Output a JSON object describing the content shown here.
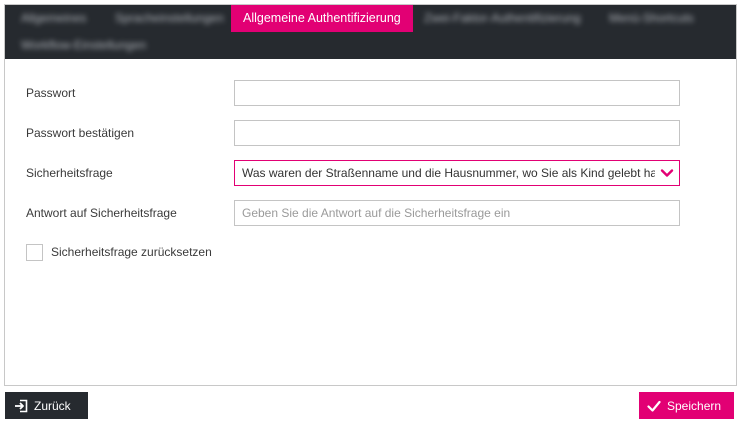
{
  "tabs": [
    {
      "label": "Allgemeines",
      "blurred": true
    },
    {
      "label": "Spracheinstellungen",
      "blurred": true
    },
    {
      "label": "Allgemeine Authentifizierung",
      "blurred": false,
      "active": true
    },
    {
      "label": "Zwei-Faktor-Authentifizierung",
      "blurred": true
    },
    {
      "label": "Menü-Shortcuts",
      "blurred": true
    },
    {
      "label": "Workflow-Einstellungen",
      "blurred": true
    }
  ],
  "form": {
    "password_label": "Passwort",
    "password_value": "",
    "confirm_label": "Passwort bestätigen",
    "confirm_value": "",
    "question_label": "Sicherheitsfrage",
    "question_selected": "Was waren der Straßenname und die Hausnummer, wo Sie als Kind gelebt haben?",
    "answer_label": "Antwort auf Sicherheitsfrage",
    "answer_placeholder": "Geben Sie die Antwort auf die Sicherheitsfrage ein",
    "reset_label": "Sicherheitsfrage zurücksetzen",
    "reset_checked": false
  },
  "buttons": {
    "back_label": "Zurück",
    "save_label": "Speichern"
  },
  "icons": {
    "back": "exit-arrow-icon",
    "save": "checkmark-icon",
    "select": "chevron-down-icon"
  },
  "colors": {
    "accent": "#e20074",
    "dark": "#262a2f"
  }
}
